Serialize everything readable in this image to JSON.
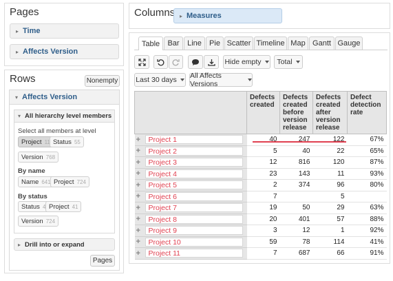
{
  "pages": {
    "title": "Pages",
    "items": [
      "Time",
      "Affects Version"
    ]
  },
  "rows": {
    "title": "Rows",
    "nonempty_label": "Nonempty",
    "dimension": "Affects Version",
    "hierarchy_label": "All hierarchy level members",
    "select_all_label": "Select all members at level",
    "level_chips": [
      {
        "label": "Project",
        "count": "11"
      },
      {
        "label": "Status",
        "count": "55"
      },
      {
        "label": "Version",
        "count": "768"
      }
    ],
    "by_name_label": "By name",
    "name_chips": [
      {
        "label": "Name",
        "count": "641"
      },
      {
        "label": "Project",
        "count": "724"
      }
    ],
    "by_status_label": "By status",
    "status_chips": [
      {
        "label": "Status",
        "count": "4"
      },
      {
        "label": "Project",
        "count": "41"
      },
      {
        "label": "Version",
        "count": "724"
      }
    ],
    "drill_label": "Drill into or expand",
    "pages_button": "Pages"
  },
  "columns": {
    "title": "Columns",
    "measure_label": "Measures"
  },
  "tabs": [
    "Table",
    "Bar",
    "Line",
    "Pie",
    "Scatter",
    "Timeline",
    "Map",
    "Gantt",
    "Gauge"
  ],
  "active_tab": "Table",
  "toolbar": {
    "icons": [
      "expand-icon",
      "undo-icon",
      "redo-icon",
      "comment-icon",
      "download-icon"
    ],
    "hide_empty": "Hide empty",
    "total": "Total",
    "last_30_days": "Last 30 days",
    "all_affects_versions": "All Affects Versions"
  },
  "table": {
    "headers": [
      "Defects created",
      "Defects created before version release",
      "Defects created after version release",
      "Defect detection rate"
    ],
    "rows": [
      {
        "name": "Project 1",
        "values": [
          "40",
          "247",
          "122",
          "67%"
        ]
      },
      {
        "name": "Project 2",
        "values": [
          "5",
          "40",
          "22",
          "65%"
        ]
      },
      {
        "name": "Project 3",
        "values": [
          "12",
          "816",
          "120",
          "87%"
        ]
      },
      {
        "name": "Project 4",
        "values": [
          "23",
          "143",
          "11",
          "93%"
        ]
      },
      {
        "name": "Project 5",
        "values": [
          "2",
          "374",
          "96",
          "80%"
        ]
      },
      {
        "name": "Project 6",
        "values": [
          "7",
          "",
          "5",
          ""
        ]
      },
      {
        "name": "Project 7",
        "values": [
          "19",
          "50",
          "29",
          "63%"
        ]
      },
      {
        "name": "Project 8",
        "values": [
          "20",
          "401",
          "57",
          "88%"
        ]
      },
      {
        "name": "Project 9",
        "values": [
          "3",
          "12",
          "1",
          "92%"
        ]
      },
      {
        "name": "Project 10",
        "values": [
          "59",
          "78",
          "114",
          "41%"
        ]
      },
      {
        "name": "Project 11",
        "values": [
          "7",
          "687",
          "66",
          "91%"
        ]
      }
    ]
  },
  "colors": {
    "link_red": "#e04050",
    "accordion_blue": "#2f5e8a",
    "measures_bg": "#dbe9f7"
  }
}
